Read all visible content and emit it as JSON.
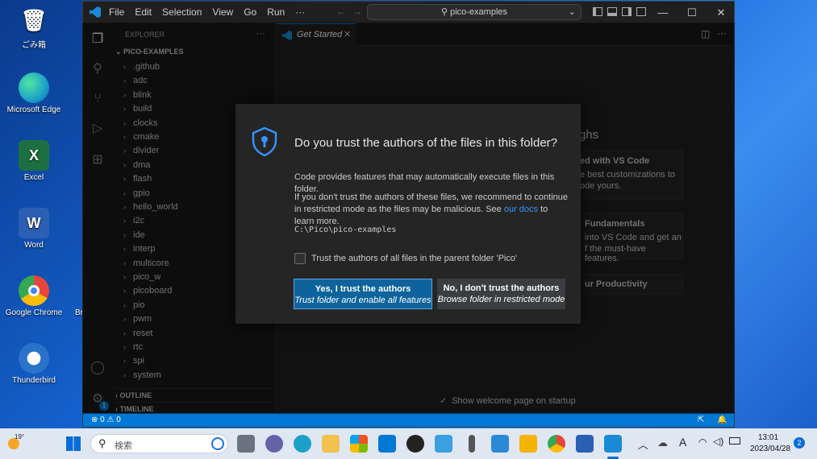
{
  "desktop": {
    "icons": [
      {
        "label": "ごみ箱",
        "icon": "recycle-bin-icon",
        "color": "#5aa0d8"
      },
      {
        "label": "Microsoft Edge",
        "icon": "edge-icon",
        "color": "#1ba1c7"
      },
      {
        "label": "Excel",
        "icon": "excel-icon",
        "color": "#1d6f42",
        "glyph": "X"
      },
      {
        "label": "Word",
        "icon": "word-icon",
        "color": "#2b5fb4",
        "glyph": "W"
      },
      {
        "label": "Google Chrome",
        "icon": "chrome-icon",
        "color": "#e8453c"
      },
      {
        "label": "Thunderbird",
        "icon": "thunderbird-icon",
        "color": "#2a73c9"
      }
    ],
    "partial_label": "Br"
  },
  "titlebar": {
    "menu": [
      "File",
      "Edit",
      "Selection",
      "View",
      "Go",
      "Run",
      "···"
    ],
    "search": "pico-examples"
  },
  "sidebar": {
    "header": "EXPLORER",
    "root": "PICO-EXAMPLES",
    "items": [
      ".github",
      "adc",
      "blink",
      "build",
      "clocks",
      "cmake",
      "divider",
      "dma",
      "flash",
      "gpio",
      "hello_world",
      "i2c",
      "ide",
      "interp",
      "multicore",
      "pico_w",
      "picoboard",
      "pio",
      "pwm",
      "reset",
      "rtc",
      "spi",
      "system"
    ],
    "sections": [
      "OUTLINE",
      "TIMELINE"
    ]
  },
  "editor": {
    "tab": "Get Started",
    "welcome": {
      "heading_fragment": "ghs",
      "card1_title": "ed with VS Code",
      "card1_line1": "e best customizations to",
      "card1_line2": "ode yours.",
      "card2_title": "Fundamentals",
      "card2_line1": " into VS Code and get an",
      "card2_line2": "f the must-have features.",
      "card3_title": "ur Productivity",
      "show_on_startup": "Show welcome page on startup"
    }
  },
  "dialog": {
    "title": "Do you trust the authors of the files in this folder?",
    "para1": "Code provides features that may automatically execute files in this folder.",
    "para2_before": "If you don't trust the authors of these files, we recommend to continue in restricted mode as the files may be malicious. See ",
    "para2_link": "our docs",
    "para2_after": " to learn more.",
    "path": "C:\\Pico\\pico-examples",
    "checkbox_label": "Trust the authors of all files in the parent folder 'Pico'",
    "yes_title": "Yes, I trust the authors",
    "yes_sub": "Trust folder and enable all features",
    "no_title": "No, I don't trust the authors",
    "no_sub": "Browse folder in restricted mode"
  },
  "statusbar": {
    "errors": "⊗ 0 ⚠ 0",
    "badge": "1"
  },
  "taskbar": {
    "weather": "19°",
    "search_placeholder": "検索",
    "time": "13:01",
    "date": "2023/04/28",
    "ime": "A",
    "notifications": "2"
  },
  "colors": {
    "accent": "#0078d4",
    "link": "#3794ff",
    "primary_button": "#0e639c",
    "secondary_button": "#3a3d41"
  }
}
